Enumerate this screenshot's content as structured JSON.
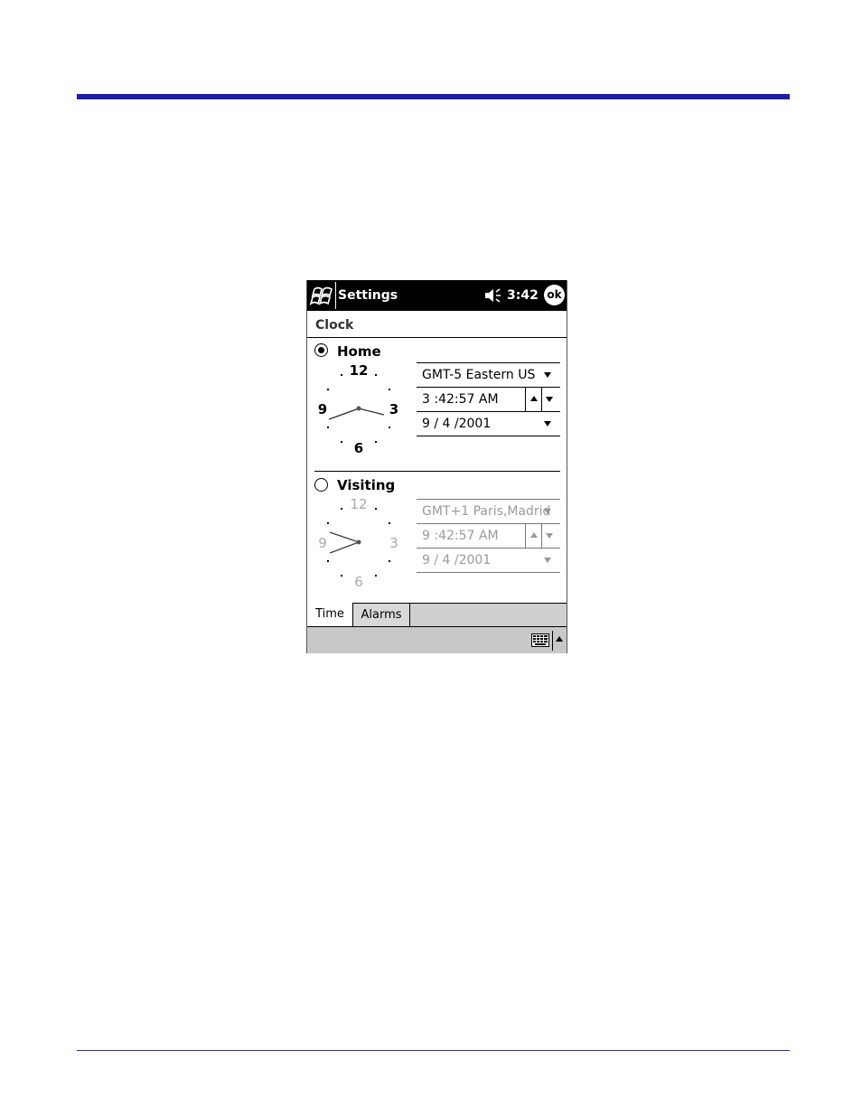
{
  "titlebar": {
    "title": "Settings",
    "time": "3:42",
    "ok_label": "ok"
  },
  "page": {
    "heading": "Clock"
  },
  "home": {
    "label": "Home",
    "selected": true,
    "timezone": "GMT-5 Eastern US",
    "time": "3 :42:57 AM",
    "date": "9 / 4 /2001",
    "clock_numerals": [
      "12",
      "3",
      "6",
      "9"
    ]
  },
  "visiting": {
    "label": "Visiting",
    "selected": false,
    "timezone": "GMT+1 Paris,Madrid",
    "time": "9 :42:57 AM",
    "date": "9 / 4 /2001",
    "clock_numerals": [
      "12",
      "3",
      "6",
      "9"
    ]
  },
  "tabs": [
    {
      "label": "Time",
      "active": true
    },
    {
      "label": "Alarms",
      "active": false
    }
  ],
  "colors": {
    "accent_rule": "#1e1ea8",
    "titlebar_bg": "#000000",
    "menubar_bg": "#c8c8c8",
    "disabled_text": "#9a9a9a"
  },
  "icons": {
    "start": "windows-flag-icon",
    "volume": "speaker-icon",
    "input_panel": "keyboard-icon"
  }
}
